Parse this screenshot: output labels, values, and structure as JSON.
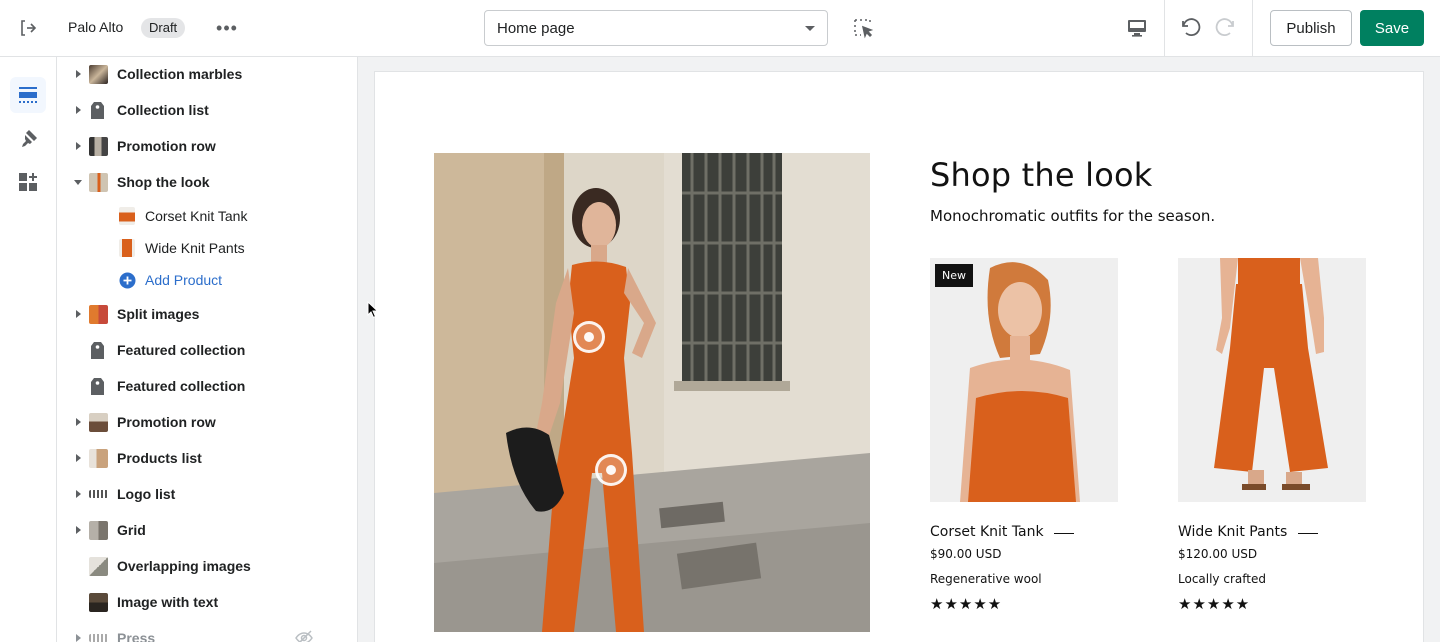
{
  "topbar": {
    "store_name": "Palo Alto",
    "draft_badge": "Draft",
    "more_label": "•••",
    "page_select_value": "Home page",
    "publish_label": "Publish",
    "save_label": "Save"
  },
  "rail": {
    "items": [
      {
        "icon": "sections-icon",
        "active": true
      },
      {
        "icon": "theme-settings-icon",
        "active": false
      },
      {
        "icon": "apps-icon",
        "active": false
      }
    ]
  },
  "sidebar": {
    "items": [
      {
        "label": "Collection marbles",
        "expanded": false,
        "has_arrow": true
      },
      {
        "label": "Collection list",
        "expanded": false,
        "has_arrow": true
      },
      {
        "label": "Promotion row",
        "expanded": false,
        "has_arrow": true
      },
      {
        "label": "Shop the look",
        "expanded": true,
        "has_arrow": true
      },
      {
        "label": "Corset Knit Tank",
        "child": true
      },
      {
        "label": "Wide Knit Pants",
        "child": true
      },
      {
        "label": "Add Product",
        "child": true,
        "add": true
      },
      {
        "label": "Split images",
        "has_arrow": true
      },
      {
        "label": "Featured collection",
        "has_arrow": false
      },
      {
        "label": "Featured collection",
        "has_arrow": false
      },
      {
        "label": "Promotion row",
        "has_arrow": true
      },
      {
        "label": "Products list",
        "has_arrow": true
      },
      {
        "label": "Logo list",
        "has_arrow": true
      },
      {
        "label": "Grid",
        "has_arrow": true
      },
      {
        "label": "Overlapping images",
        "has_arrow": false
      },
      {
        "label": "Image with text",
        "has_arrow": false
      },
      {
        "label": "Press",
        "has_arrow": true,
        "hidden": true
      }
    ]
  },
  "preview": {
    "section_title": "Shop the look",
    "section_subtitle": "Monochromatic outfits for the season.",
    "products": [
      {
        "name": "Corset Knit Tank",
        "price": "$90.00 USD",
        "description": "Regenerative wool",
        "badge": "New",
        "stars": "★★★★★"
      },
      {
        "name": "Wide Knit Pants",
        "price": "$120.00 USD",
        "description": "Locally crafted",
        "badge": "",
        "stars": "★★★★★"
      }
    ]
  },
  "colors": {
    "accent_green": "#008060",
    "link_blue": "#2c6ecb",
    "product_orange": "#d9601c"
  }
}
